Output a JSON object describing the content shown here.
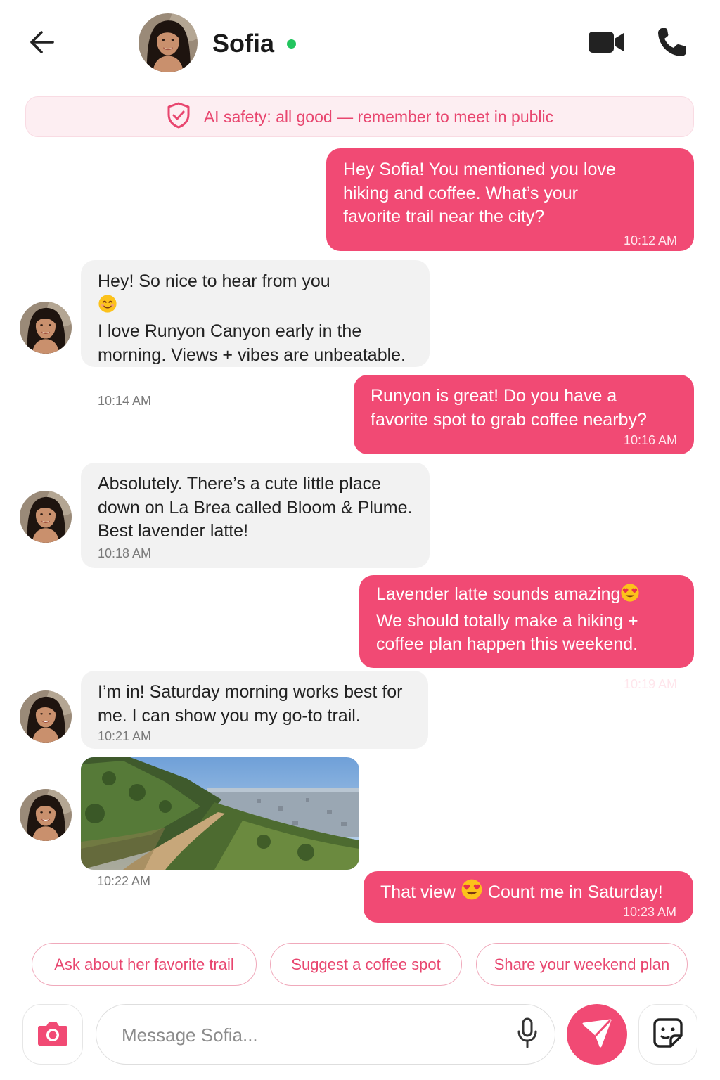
{
  "header": {
    "contact_name": "Sofia",
    "icons": {
      "back": "arrow-left-icon",
      "video": "video-camera-icon",
      "call": "phone-icon",
      "online": "online-status-dot"
    }
  },
  "safety_banner": {
    "text": "AI safety: all good — remember to meet in public",
    "icon": "shield-check-icon"
  },
  "messages": [
    {
      "direction": "outgoing",
      "text": "Hey Sofia! You mentioned you love\nhiking and coffee. What’s your\nfavorite trail near the city?",
      "time": "10:12 AM"
    },
    {
      "direction": "incoming",
      "text_line1": "Hey! So nice to hear from you",
      "emoji": "smiling-face",
      "text_rest": "I love Runyon Canyon early in the\nmorning. Views + vibes are unbeatable.",
      "time": "10:14 AM"
    },
    {
      "direction": "outgoing",
      "text": "Runyon is great! Do you have a\nfavorite spot to grab coffee nearby?",
      "time": "10:16 AM"
    },
    {
      "direction": "incoming",
      "text": "Absolutely. There’s a cute little place\ndown on La Brea called Bloom & Plume.\nBest lavender latte!",
      "time": "10:18 AM"
    },
    {
      "direction": "outgoing",
      "text_line1": "Lavender latte sounds amazing",
      "emoji": "heart-eyes",
      "text_rest": "We should totally make a hiking +\ncoffee plan happen this weekend.",
      "time": "10:19 AM"
    },
    {
      "direction": "incoming",
      "text": "I’m in! Saturday morning works best for\nme. I can show you my go-to trail.",
      "time": "10:21 AM"
    },
    {
      "direction": "incoming",
      "type": "photo",
      "description": "trail-view-photo",
      "time": "10:22 AM"
    },
    {
      "direction": "outgoing",
      "text_before": "That view",
      "emoji": "heart-eyes",
      "text_after": "Count me in Saturday!",
      "time": "10:23 AM"
    }
  ],
  "suggestions": [
    "Ask about her favorite trail",
    "Suggest a coffee spot",
    "Share your weekend plan"
  ],
  "composer": {
    "placeholder": "Message Sofia...",
    "icons": {
      "camera": "camera-icon",
      "mic": "microphone-icon",
      "send": "send-icon",
      "sticker": "sticker-icon"
    }
  },
  "colors": {
    "accent": "#f14a74",
    "banner_bg": "#fdeef2",
    "incoming_bubble": "#f2f2f2",
    "online": "#22c55e"
  }
}
